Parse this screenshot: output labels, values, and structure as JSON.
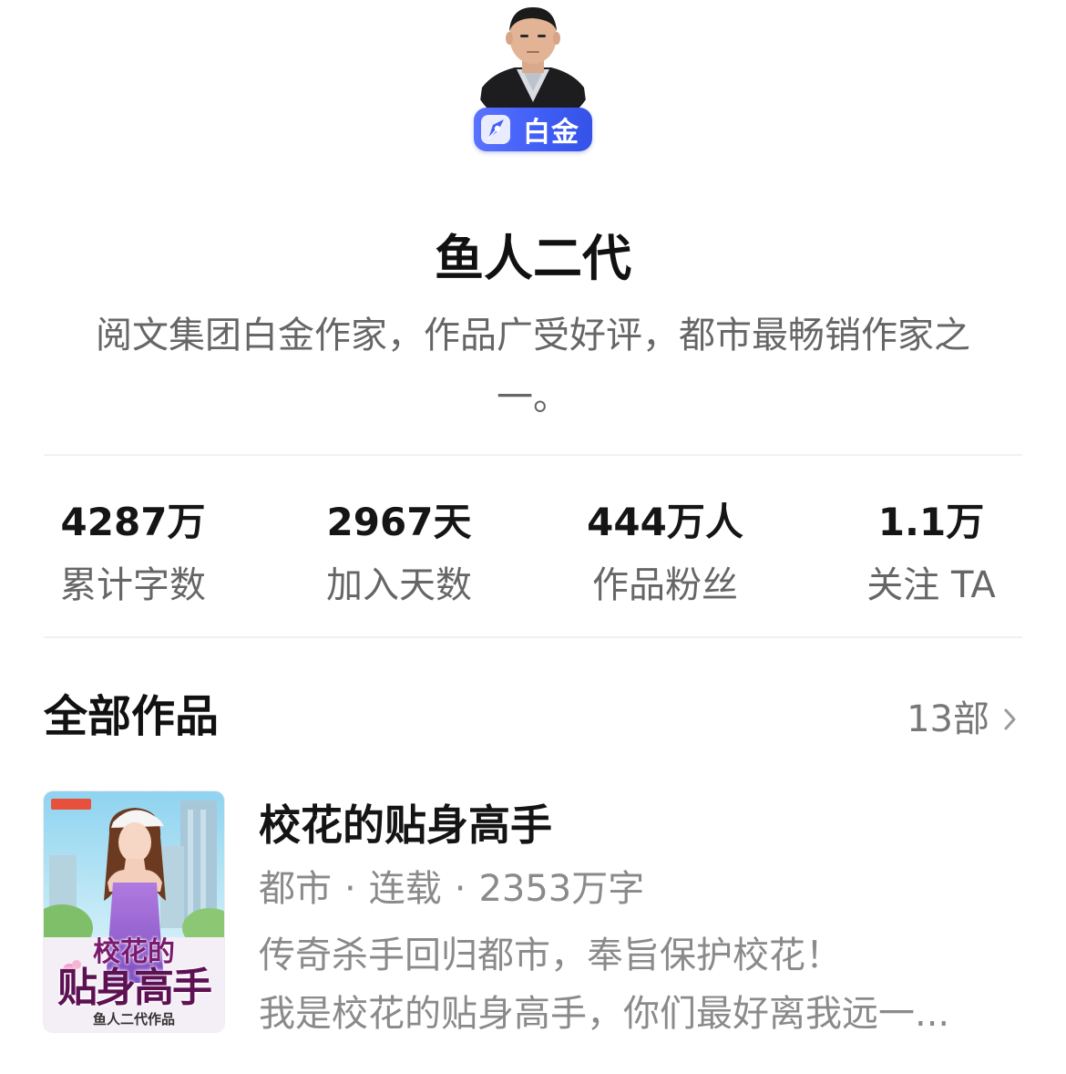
{
  "author": {
    "name": "鱼人二代",
    "level_badge": "白金",
    "bio": "阅文集团白金作家，作品广受好评，都市最畅销作家之一。"
  },
  "stats": [
    {
      "value": "4287万",
      "label": "累计字数"
    },
    {
      "value": "2967天",
      "label": "加入天数"
    },
    {
      "value": "444万人",
      "label": "作品粉丝"
    },
    {
      "value": "1.1万",
      "label": "关注 TA"
    }
  ],
  "works": {
    "title": "全部作品",
    "count": "13部",
    "books": [
      {
        "title": "校花的贴身高手",
        "cover_line1": "校花的",
        "cover_line2": "贴身高手",
        "cover_author": "鱼人二代作品",
        "genre": "都市",
        "status": "连载",
        "word_count": "2353万字",
        "desc_line1": "传奇杀手回归都市，奉旨保护校花！",
        "desc_line2": "我是校花的贴身高手，你们最好离我远一..."
      }
    ]
  },
  "colors": {
    "badge": "#4560f7",
    "text_primary": "#111111",
    "text_secondary": "#666666",
    "text_muted": "#8a8a8a"
  },
  "icons": {
    "badge": "pen-nib-icon",
    "more": "chevron-right-icon"
  }
}
